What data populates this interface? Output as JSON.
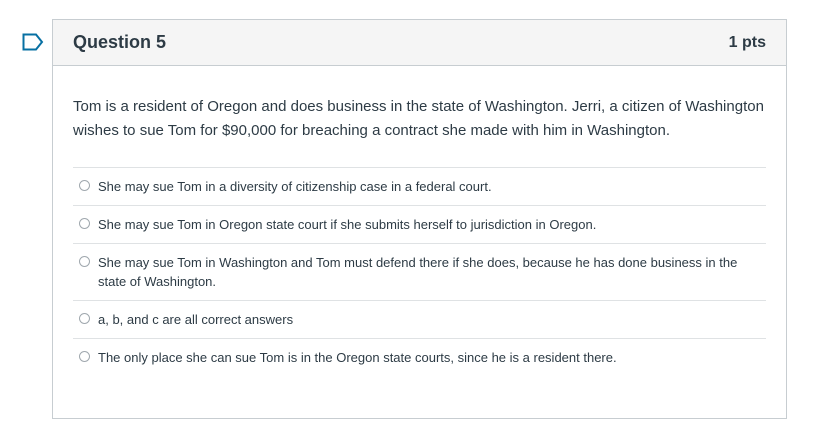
{
  "question": {
    "title": "Question 5",
    "points": "1 pts",
    "text": "Tom is a resident of Oregon and does business in the state of Washington. Jerri, a citizen of Washington wishes to sue Tom for $90,000 for breaching a contract she made with him in Washington.",
    "answers": [
      "She may sue Tom in a diversity of citizenship case in a federal court.",
      "She may sue Tom in Oregon state court if she submits herself to jurisdiction in Oregon.",
      "She may sue Tom in Washington and Tom must defend there if she does, because he has done business in the state of Washington.",
      "a, b, and c are all correct answers",
      "The only place she can sue Tom is in the Oregon state courts, since he is a resident there."
    ]
  },
  "icons": {
    "flag": "flag-question-icon"
  },
  "colors": {
    "flag_accent": "#0770a3",
    "border": "#c7cdd1",
    "header_bg": "#f5f5f5",
    "text": "#2d3b45"
  }
}
